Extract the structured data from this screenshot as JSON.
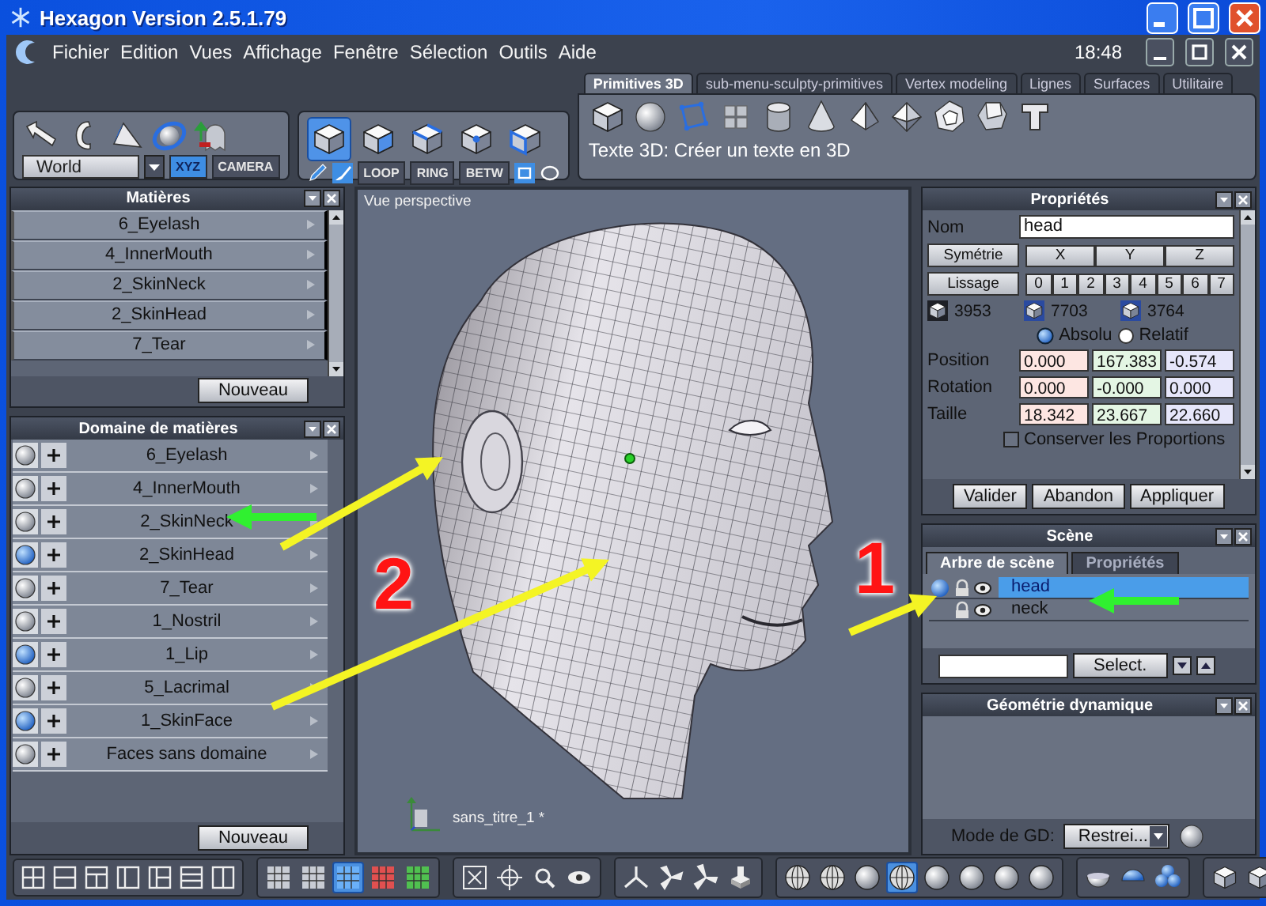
{
  "window": {
    "title": "Hexagon Version 2.5.1.79"
  },
  "menu": {
    "items": [
      "Fichier",
      "Edition",
      "Vues",
      "Affichage",
      "Fenêtre",
      "Sélection",
      "Outils",
      "Aide"
    ],
    "clock": "18:48"
  },
  "tool_palette": {
    "space_dropdown": {
      "value": "World"
    },
    "view_modes": [
      {
        "label": "XYZ",
        "selected": true
      },
      {
        "label": "CAMERA",
        "selected": false
      }
    ]
  },
  "selection_palette": {
    "modes": [
      {
        "selected": true
      },
      {
        "selected": false
      },
      {
        "selected": false
      },
      {
        "selected": false
      },
      {
        "selected": false
      }
    ],
    "edge_tools": [
      "LOOP",
      "RING",
      "BETW"
    ]
  },
  "module_tabs": [
    {
      "label": "Primitives 3D",
      "selected": true
    },
    {
      "label": "sub-menu-sculpty-primitives",
      "selected": false
    },
    {
      "label": "Vertex modeling",
      "selected": false
    },
    {
      "label": "Lignes",
      "selected": false
    },
    {
      "label": "Surfaces",
      "selected": false
    },
    {
      "label": "Utilitaire",
      "selected": false
    }
  ],
  "tool_hint": "Texte 3D: Créer un texte en 3D",
  "materials_panel": {
    "title": "Matières",
    "items": [
      "6_Eyelash",
      "4_InnerMouth",
      "2_SkinNeck",
      "2_SkinHead",
      "7_Tear"
    ],
    "button": "Nouveau"
  },
  "material_domains_panel": {
    "title": "Domaine de matières",
    "items": [
      {
        "name": "6_Eyelash",
        "active": false
      },
      {
        "name": "4_InnerMouth",
        "active": false
      },
      {
        "name": "2_SkinNeck",
        "active": false
      },
      {
        "name": "2_SkinHead",
        "active": true
      },
      {
        "name": "7_Tear",
        "active": false
      },
      {
        "name": "1_Nostril",
        "active": false
      },
      {
        "name": "1_Lip",
        "active": true
      },
      {
        "name": "5_Lacrimal",
        "active": false
      },
      {
        "name": "1_SkinFace",
        "active": true
      },
      {
        "name": "Faces sans domaine",
        "active": false
      }
    ],
    "button": "Nouveau"
  },
  "viewport": {
    "title": "Vue perspective",
    "document": "sans_titre_1 *"
  },
  "annotations": {
    "numbers": [
      "2",
      "1"
    ]
  },
  "properties_panel": {
    "title": "Propriétés",
    "name_label": "Nom",
    "name_value": "head",
    "symmetry_button": "Symétrie",
    "axes": [
      "X",
      "Y",
      "Z"
    ],
    "smoothing_button": "Lissage",
    "smoothing_levels": [
      "0",
      "1",
      "2",
      "3",
      "4",
      "5",
      "6",
      "7"
    ],
    "counts": [
      "3953",
      "7703",
      "3764"
    ],
    "coordinate_modes": [
      {
        "label": "Absolu",
        "selected": true
      },
      {
        "label": "Relatif",
        "selected": false
      }
    ],
    "transforms": [
      {
        "label": "Position",
        "values": [
          "0.000",
          "167.383",
          "-0.574"
        ]
      },
      {
        "label": "Rotation",
        "values": [
          "0.000",
          "-0.000",
          "0.000"
        ]
      },
      {
        "label": "Taille",
        "values": [
          "18.342",
          "23.667",
          "22.660"
        ]
      }
    ],
    "keep_proportions": {
      "label": "Conserver les Proportions",
      "checked": false
    },
    "buttons": [
      "Valider",
      "Abandon",
      "Appliquer"
    ]
  },
  "scene_panel": {
    "title": "Scène",
    "tabs": [
      {
        "label": "Arbre de scène",
        "selected": true
      },
      {
        "label": "Propriétés",
        "selected": false
      }
    ],
    "objects": [
      {
        "name": "head",
        "selected": true
      },
      {
        "name": "neck",
        "selected": false
      }
    ],
    "select_button": "Select."
  },
  "dynamic_geometry_panel": {
    "title": "Géométrie dynamique",
    "mode_label": "Mode de GD:",
    "mode_value": "Restrei..."
  },
  "bottom_toolbar": {
    "grid_modes": [
      {
        "selected": false
      },
      {
        "selected": false
      },
      {
        "selected": true
      },
      {
        "selected": false
      },
      {
        "selected": false
      }
    ],
    "shading_modes": [
      {
        "selected": false
      },
      {
        "selected": false
      },
      {
        "selected": false
      },
      {
        "selected": true
      },
      {
        "selected": false
      },
      {
        "selected": false
      },
      {
        "selected": false
      },
      {
        "selected": false
      }
    ]
  }
}
